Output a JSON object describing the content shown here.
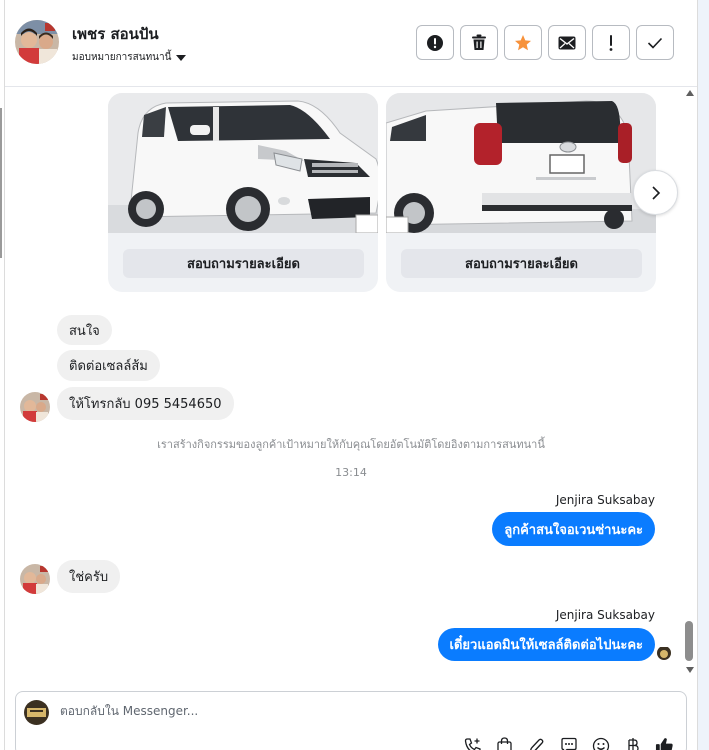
{
  "header": {
    "contact_name": "เพชร สอนปัน",
    "assign_label": "มอบหมายการสนทนานี้",
    "toolbar": [
      {
        "name": "report-spam-button",
        "icon": "alert-circle-icon"
      },
      {
        "name": "delete-button",
        "icon": "trash-icon"
      },
      {
        "name": "star-button",
        "icon": "star-icon",
        "color": "#f7923b"
      },
      {
        "name": "mark-unread-button",
        "icon": "envelope-icon"
      },
      {
        "name": "follow-up-button",
        "icon": "exclamation-icon"
      },
      {
        "name": "mark-done-button",
        "icon": "checkmark-icon"
      }
    ]
  },
  "carousel": {
    "cards": [
      {
        "button_label": "สอบถามรายละเอียด",
        "image": "white-minivan-front-photo"
      },
      {
        "button_label": "สอบถามรายละเอียด",
        "image": "white-minivan-rear-photo"
      }
    ],
    "next_icon": "chevron-right-icon"
  },
  "messages": {
    "incoming_1": "สนใจ",
    "incoming_2": "ติดต่อเซลล์ส้ม",
    "incoming_3": "ให้โทรกลับ  095 5454650",
    "system_note": "เราสร้างกิจกรรมของลูกค้าเป้าหมายให้กับคุณโดยอัตโนมัติโดยอิงตามการสนทนานี้",
    "timestamp": "13:14",
    "sender_1": "Jenjira Suksabay",
    "outgoing_1": "ลูกค้าสนใจอเวนซ่านะคะ",
    "incoming_4": "ใช่ครับ",
    "sender_2": "Jenjira Suksabay",
    "outgoing_2": "เดี๋ยวแอดมินให้เซลล์ติดต่อไปนะคะ"
  },
  "composer": {
    "placeholder": "ตอบกลับใน Messenger...",
    "tools": [
      "phone-add-icon",
      "shopping-bag-icon",
      "paperclip-icon",
      "chat-template-icon",
      "emoji-icon",
      "baht-icon",
      "thumbs-up-icon"
    ]
  },
  "colors": {
    "accent": "#0a7cff",
    "star": "#f7923b",
    "incoming_bubble": "#f0f0f0"
  }
}
